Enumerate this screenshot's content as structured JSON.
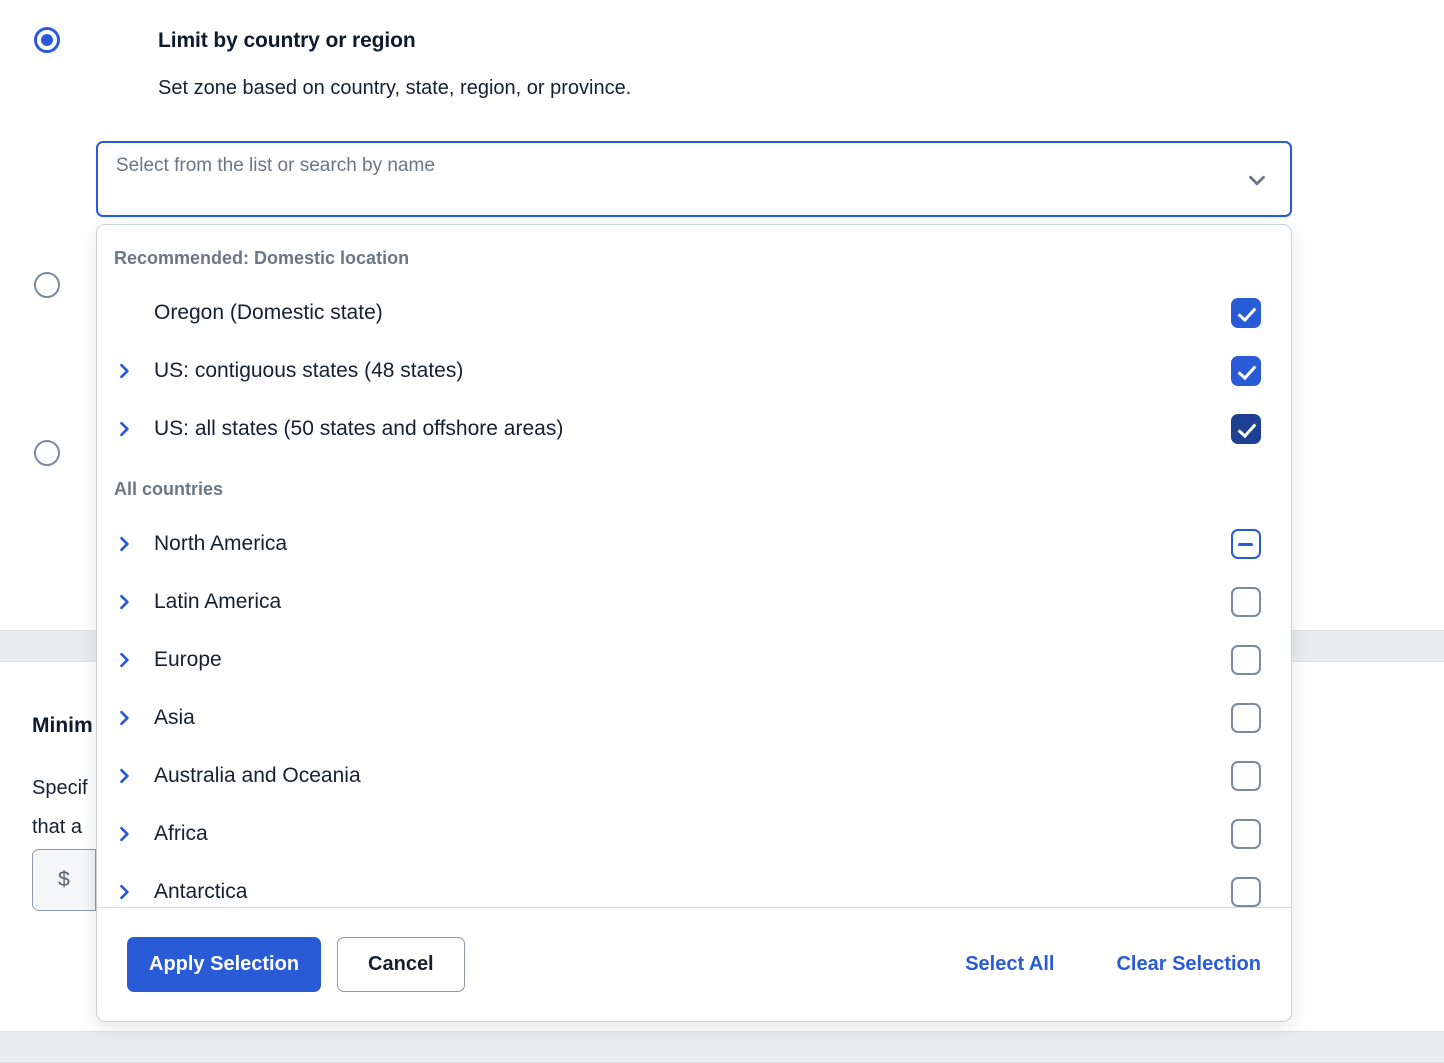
{
  "background": {
    "radio_options": [
      {
        "id": "limit-by-country-or-region",
        "title": "Limit by country or region",
        "description": "Set zone based on country, state, region, or province.",
        "selected": true
      },
      {
        "id": "option-2",
        "title": "",
        "description": "",
        "selected": false
      },
      {
        "id": "option-3",
        "title": "",
        "description": "",
        "selected": false
      }
    ],
    "select": {
      "placeholder": "Select from the list or search by name",
      "value": "",
      "chevron_icon": "chevron-down-icon"
    },
    "obscured_section": {
      "heading": "Minim",
      "paragraph_line_1": "Specif",
      "paragraph_line_2": "that a",
      "money_prefix": "$",
      "money_value": ""
    }
  },
  "dropdown": {
    "groups": [
      {
        "header": "Recommended: Domestic location",
        "items": [
          {
            "label": "Oregon (Domestic state)",
            "expandable": false,
            "checkbox": "checked"
          },
          {
            "label": "US: contiguous states (48 states)",
            "expandable": true,
            "checkbox": "checked"
          },
          {
            "label": "US: all states (50 states and offshore areas)",
            "expandable": true,
            "checkbox": "checked-dark"
          }
        ]
      },
      {
        "header": "All countries",
        "items": [
          {
            "label": "North America",
            "expandable": true,
            "checkbox": "indeterminate"
          },
          {
            "label": "Latin America",
            "expandable": true,
            "checkbox": "unchecked"
          },
          {
            "label": "Europe",
            "expandable": true,
            "checkbox": "unchecked"
          },
          {
            "label": "Asia",
            "expandable": true,
            "checkbox": "unchecked"
          },
          {
            "label": "Australia and Oceania",
            "expandable": true,
            "checkbox": "unchecked"
          },
          {
            "label": "Africa",
            "expandable": true,
            "checkbox": "unchecked"
          },
          {
            "label": "Antarctica",
            "expandable": true,
            "checkbox": "unchecked"
          }
        ]
      }
    ],
    "footer": {
      "apply_label": "Apply Selection",
      "cancel_label": "Cancel",
      "select_all_label": "Select All",
      "clear_selection_label": "Clear Selection"
    }
  },
  "colors": {
    "accent_blue": "#2a5bd7",
    "accent_blue_dark": "#1f3f93",
    "border_gray": "#7c8a9c",
    "muted_text": "#6b7785",
    "band_gray": "#e9ecef"
  }
}
